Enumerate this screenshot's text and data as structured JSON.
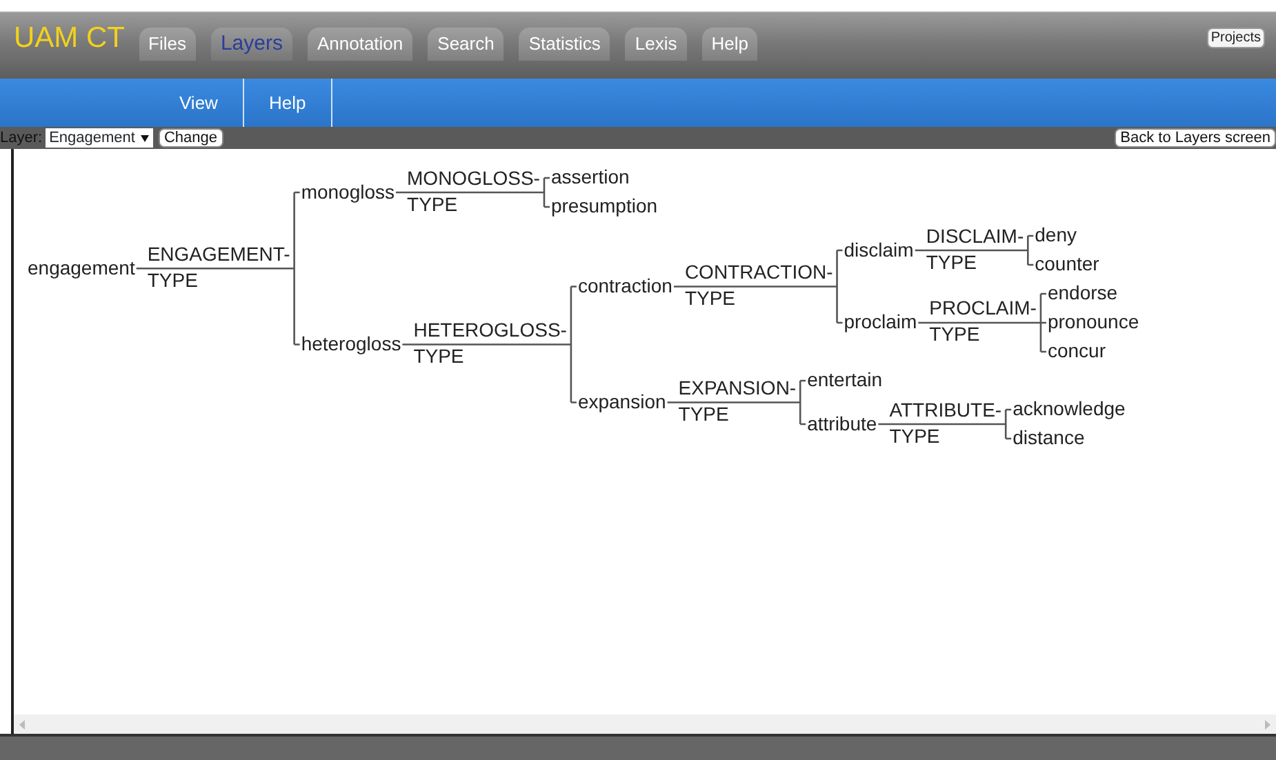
{
  "app_title": "UAM CT",
  "projects_button": "Projects",
  "tabs": [
    {
      "label": "Files",
      "selected": false
    },
    {
      "label": "Layers",
      "selected": true
    },
    {
      "label": "Annotation",
      "selected": false
    },
    {
      "label": "Search",
      "selected": false
    },
    {
      "label": "Statistics",
      "selected": false
    },
    {
      "label": "Lexis",
      "selected": false
    },
    {
      "label": "Help",
      "selected": false
    }
  ],
  "submenu": [
    "View",
    "Help"
  ],
  "layer_bar": {
    "label": "Layer:",
    "value": "Engagement",
    "change_button": "Change",
    "back_button": "Back to Layers screen"
  },
  "network": {
    "feature": "engagement",
    "system": [
      "ENGAGEMENT-",
      "TYPE"
    ],
    "children": [
      {
        "feature": "monogloss",
        "system": [
          "MONOGLOSS-",
          "TYPE"
        ],
        "children": [
          {
            "feature": "assertion"
          },
          {
            "feature": "presumption"
          }
        ]
      },
      {
        "feature": "heterogloss",
        "system": [
          "HETEROGLOSS-",
          "TYPE"
        ],
        "children": [
          {
            "feature": "contraction",
            "system": [
              "CONTRACTION-",
              "TYPE"
            ],
            "children": [
              {
                "feature": "disclaim",
                "system": [
                  "DISCLAIM-",
                  "TYPE"
                ],
                "children": [
                  {
                    "feature": "deny"
                  },
                  {
                    "feature": "counter"
                  }
                ]
              },
              {
                "feature": "proclaim",
                "system": [
                  "PROCLAIM-",
                  "TYPE"
                ],
                "children": [
                  {
                    "feature": "endorse"
                  },
                  {
                    "feature": "pronounce"
                  },
                  {
                    "feature": "concur"
                  }
                ]
              }
            ]
          },
          {
            "feature": "expansion",
            "system": [
              "EXPANSION-",
              "TYPE"
            ],
            "children": [
              {
                "feature": "entertain"
              },
              {
                "feature": "attribute",
                "system": [
                  "ATTRIBUTE-",
                  "TYPE"
                ],
                "children": [
                  {
                    "feature": "acknowledge"
                  },
                  {
                    "feature": "distance"
                  }
                ]
              }
            ]
          }
        ]
      }
    ]
  }
}
